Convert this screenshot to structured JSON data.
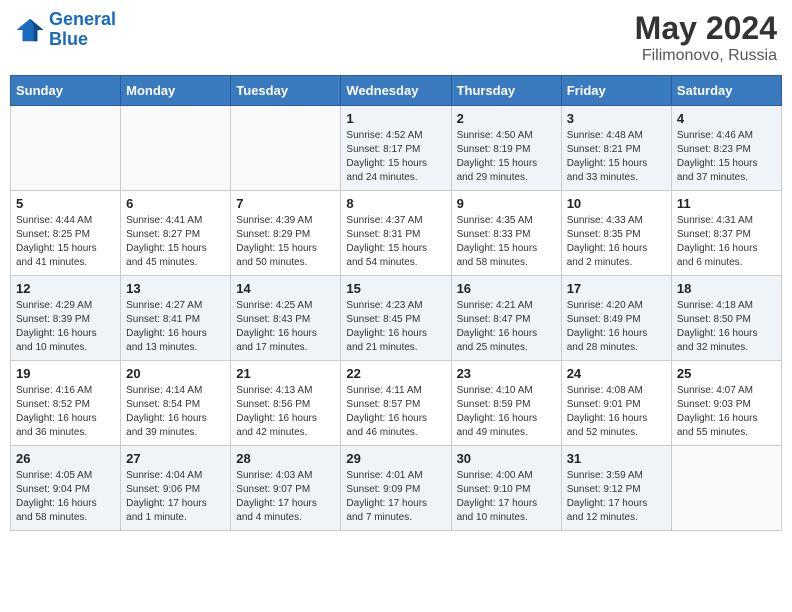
{
  "header": {
    "logo_line1": "General",
    "logo_line2": "Blue",
    "main_title": "May 2024",
    "subtitle": "Filimonovo, Russia"
  },
  "days_of_week": [
    "Sunday",
    "Monday",
    "Tuesday",
    "Wednesday",
    "Thursday",
    "Friday",
    "Saturday"
  ],
  "weeks": [
    {
      "days": [
        {
          "number": "",
          "info": ""
        },
        {
          "number": "",
          "info": ""
        },
        {
          "number": "",
          "info": ""
        },
        {
          "number": "1",
          "info": "Sunrise: 4:52 AM\nSunset: 8:17 PM\nDaylight: 15 hours\nand 24 minutes."
        },
        {
          "number": "2",
          "info": "Sunrise: 4:50 AM\nSunset: 8:19 PM\nDaylight: 15 hours\nand 29 minutes."
        },
        {
          "number": "3",
          "info": "Sunrise: 4:48 AM\nSunset: 8:21 PM\nDaylight: 15 hours\nand 33 minutes."
        },
        {
          "number": "4",
          "info": "Sunrise: 4:46 AM\nSunset: 8:23 PM\nDaylight: 15 hours\nand 37 minutes."
        }
      ]
    },
    {
      "days": [
        {
          "number": "5",
          "info": "Sunrise: 4:44 AM\nSunset: 8:25 PM\nDaylight: 15 hours\nand 41 minutes."
        },
        {
          "number": "6",
          "info": "Sunrise: 4:41 AM\nSunset: 8:27 PM\nDaylight: 15 hours\nand 45 minutes."
        },
        {
          "number": "7",
          "info": "Sunrise: 4:39 AM\nSunset: 8:29 PM\nDaylight: 15 hours\nand 50 minutes."
        },
        {
          "number": "8",
          "info": "Sunrise: 4:37 AM\nSunset: 8:31 PM\nDaylight: 15 hours\nand 54 minutes."
        },
        {
          "number": "9",
          "info": "Sunrise: 4:35 AM\nSunset: 8:33 PM\nDaylight: 15 hours\nand 58 minutes."
        },
        {
          "number": "10",
          "info": "Sunrise: 4:33 AM\nSunset: 8:35 PM\nDaylight: 16 hours\nand 2 minutes."
        },
        {
          "number": "11",
          "info": "Sunrise: 4:31 AM\nSunset: 8:37 PM\nDaylight: 16 hours\nand 6 minutes."
        }
      ]
    },
    {
      "days": [
        {
          "number": "12",
          "info": "Sunrise: 4:29 AM\nSunset: 8:39 PM\nDaylight: 16 hours\nand 10 minutes."
        },
        {
          "number": "13",
          "info": "Sunrise: 4:27 AM\nSunset: 8:41 PM\nDaylight: 16 hours\nand 13 minutes."
        },
        {
          "number": "14",
          "info": "Sunrise: 4:25 AM\nSunset: 8:43 PM\nDaylight: 16 hours\nand 17 minutes."
        },
        {
          "number": "15",
          "info": "Sunrise: 4:23 AM\nSunset: 8:45 PM\nDaylight: 16 hours\nand 21 minutes."
        },
        {
          "number": "16",
          "info": "Sunrise: 4:21 AM\nSunset: 8:47 PM\nDaylight: 16 hours\nand 25 minutes."
        },
        {
          "number": "17",
          "info": "Sunrise: 4:20 AM\nSunset: 8:49 PM\nDaylight: 16 hours\nand 28 minutes."
        },
        {
          "number": "18",
          "info": "Sunrise: 4:18 AM\nSunset: 8:50 PM\nDaylight: 16 hours\nand 32 minutes."
        }
      ]
    },
    {
      "days": [
        {
          "number": "19",
          "info": "Sunrise: 4:16 AM\nSunset: 8:52 PM\nDaylight: 16 hours\nand 36 minutes."
        },
        {
          "number": "20",
          "info": "Sunrise: 4:14 AM\nSunset: 8:54 PM\nDaylight: 16 hours\nand 39 minutes."
        },
        {
          "number": "21",
          "info": "Sunrise: 4:13 AM\nSunset: 8:56 PM\nDaylight: 16 hours\nand 42 minutes."
        },
        {
          "number": "22",
          "info": "Sunrise: 4:11 AM\nSunset: 8:57 PM\nDaylight: 16 hours\nand 46 minutes."
        },
        {
          "number": "23",
          "info": "Sunrise: 4:10 AM\nSunset: 8:59 PM\nDaylight: 16 hours\nand 49 minutes."
        },
        {
          "number": "24",
          "info": "Sunrise: 4:08 AM\nSunset: 9:01 PM\nDaylight: 16 hours\nand 52 minutes."
        },
        {
          "number": "25",
          "info": "Sunrise: 4:07 AM\nSunset: 9:03 PM\nDaylight: 16 hours\nand 55 minutes."
        }
      ]
    },
    {
      "days": [
        {
          "number": "26",
          "info": "Sunrise: 4:05 AM\nSunset: 9:04 PM\nDaylight: 16 hours\nand 58 minutes."
        },
        {
          "number": "27",
          "info": "Sunrise: 4:04 AM\nSunset: 9:06 PM\nDaylight: 17 hours\nand 1 minute."
        },
        {
          "number": "28",
          "info": "Sunrise: 4:03 AM\nSunset: 9:07 PM\nDaylight: 17 hours\nand 4 minutes."
        },
        {
          "number": "29",
          "info": "Sunrise: 4:01 AM\nSunset: 9:09 PM\nDaylight: 17 hours\nand 7 minutes."
        },
        {
          "number": "30",
          "info": "Sunrise: 4:00 AM\nSunset: 9:10 PM\nDaylight: 17 hours\nand 10 minutes."
        },
        {
          "number": "31",
          "info": "Sunrise: 3:59 AM\nSunset: 9:12 PM\nDaylight: 17 hours\nand 12 minutes."
        },
        {
          "number": "",
          "info": ""
        }
      ]
    }
  ]
}
